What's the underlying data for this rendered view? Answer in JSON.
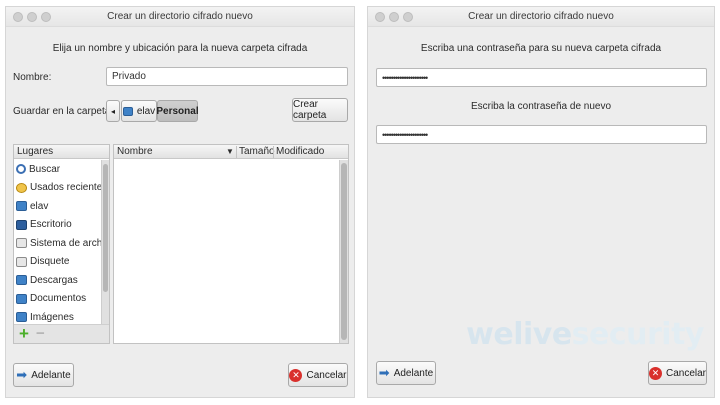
{
  "left_dialog": {
    "title": "Crear un directorio cifrado nuevo",
    "heading": "Elija un nombre y ubicación para la nueva carpeta cifrada",
    "name_label": "Nombre:",
    "name_value": "Privado",
    "save_in_label": "Guardar en la carpeta:",
    "path_back": "◂",
    "path_segments": [
      "elav",
      "Personal"
    ],
    "create_folder_button": "Crear carpeta",
    "places": {
      "header": "Lugares",
      "items": [
        {
          "label": "Buscar",
          "icon": "search-icon"
        },
        {
          "label": "Usados reciente...",
          "icon": "recent-icon"
        },
        {
          "label": "elav",
          "icon": "home-folder-icon"
        },
        {
          "label": "Escritorio",
          "icon": "desktop-icon"
        },
        {
          "label": "Sistema de archi...",
          "icon": "filesystem-icon"
        },
        {
          "label": "Disquete",
          "icon": "floppy-icon"
        },
        {
          "label": "Descargas",
          "icon": "folder-icon"
        },
        {
          "label": "Documentos",
          "icon": "folder-icon"
        },
        {
          "label": "Imágenes",
          "icon": "folder-icon"
        }
      ],
      "add_symbol": "+",
      "remove_symbol": "−"
    },
    "files": {
      "columns": [
        "Nombre",
        "Tamaño",
        "Modificado"
      ],
      "sort_arrow": "▼",
      "rows": []
    },
    "forward_button": "Adelante",
    "cancel_button": "Cancelar"
  },
  "right_dialog": {
    "title": "Crear un directorio cifrado nuevo",
    "password_prompt": "Escriba una contraseña para su nueva carpeta cifrada",
    "password_value": "•••••••••••••••••••••",
    "confirm_prompt": "Escriba la contraseña de nuevo",
    "confirm_value": "•••••••••••••••••••••",
    "forward_button": "Adelante",
    "cancel_button": "Cancelar"
  },
  "watermark": {
    "part1": "welive",
    "part2": "security"
  },
  "colors": {
    "accent_blue": "#2f6fb8",
    "cancel_red": "#d9302c",
    "add_green": "#4caf2a"
  }
}
